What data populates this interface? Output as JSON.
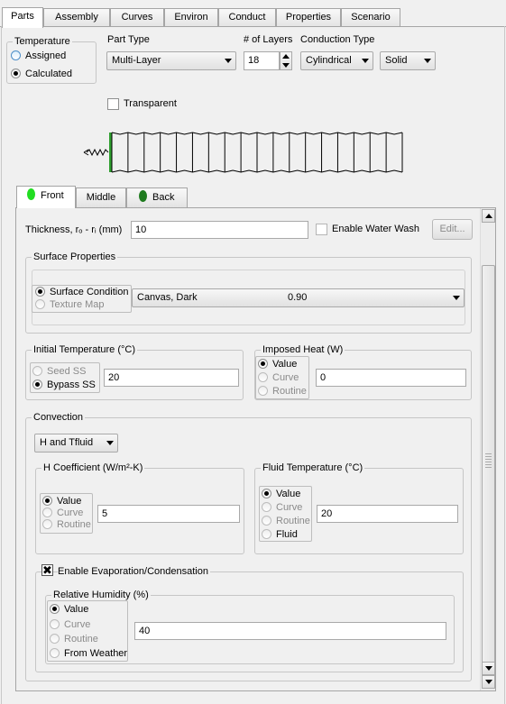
{
  "top_tabs": [
    "Parts",
    "Assembly",
    "Curves",
    "Environ",
    "Conduct",
    "Properties",
    "Scenario"
  ],
  "temperature": {
    "title": "Temperature",
    "options": [
      "Assigned",
      "Calculated"
    ],
    "selected": "Calculated"
  },
  "part_type": {
    "label": "Part Type",
    "value": "Multi-Layer"
  },
  "layers": {
    "label": "# of Layers",
    "value": "18"
  },
  "conduction": {
    "label": "Conduction Type",
    "value": "Cylindrical",
    "value2": "Solid"
  },
  "transparent": {
    "label": "Transparent",
    "checked": false
  },
  "preview": {
    "layer_count": 18,
    "front_color": "#2e9e2e"
  },
  "inner_tabs": {
    "front": "Front",
    "middle": "Middle",
    "back": "Back",
    "front_color": "#22dd22",
    "back_color": "#1e7a1e"
  },
  "thickness": {
    "label": "Thickness, rₒ - rᵢ (mm)",
    "value": "10"
  },
  "water_wash": {
    "label": "Enable Water Wash",
    "checked": false,
    "edit_button": "Edit..."
  },
  "surface_properties": {
    "title": "Surface Properties",
    "options": [
      "Surface Condition",
      "Texture Map"
    ],
    "selected": "Surface Condition",
    "condition_name": "Canvas, Dark",
    "condition_value": "0.90"
  },
  "initial_temperature": {
    "title": "Initial Temperature (°C)",
    "options": [
      "Seed SS",
      "Bypass SS"
    ],
    "selected": "Bypass SS",
    "value": "20"
  },
  "imposed_heat": {
    "title": "Imposed Heat (W)",
    "options": [
      "Value",
      "Curve",
      "Routine"
    ],
    "selected": "Value",
    "value": "0"
  },
  "convection": {
    "title": "Convection",
    "mode": "H and Tfluid",
    "h_coefficient": {
      "title": "H Coefficient (W/m²-K)",
      "options": [
        "Value",
        "Curve",
        "Routine"
      ],
      "selected": "Value",
      "value": "5"
    },
    "fluid_temperature": {
      "title": "Fluid Temperature (°C)",
      "options": [
        "Value",
        "Curve",
        "Routine",
        "Fluid"
      ],
      "selected": "Value",
      "value": "20"
    },
    "evaporation": {
      "label": "Enable Evaporation/Condensation",
      "checked": true,
      "humidity": {
        "title": "Relative Humidity (%)",
        "options": [
          "Value",
          "Curve",
          "Routine",
          "From Weather"
        ],
        "selected": "Value",
        "value": "40"
      }
    }
  }
}
